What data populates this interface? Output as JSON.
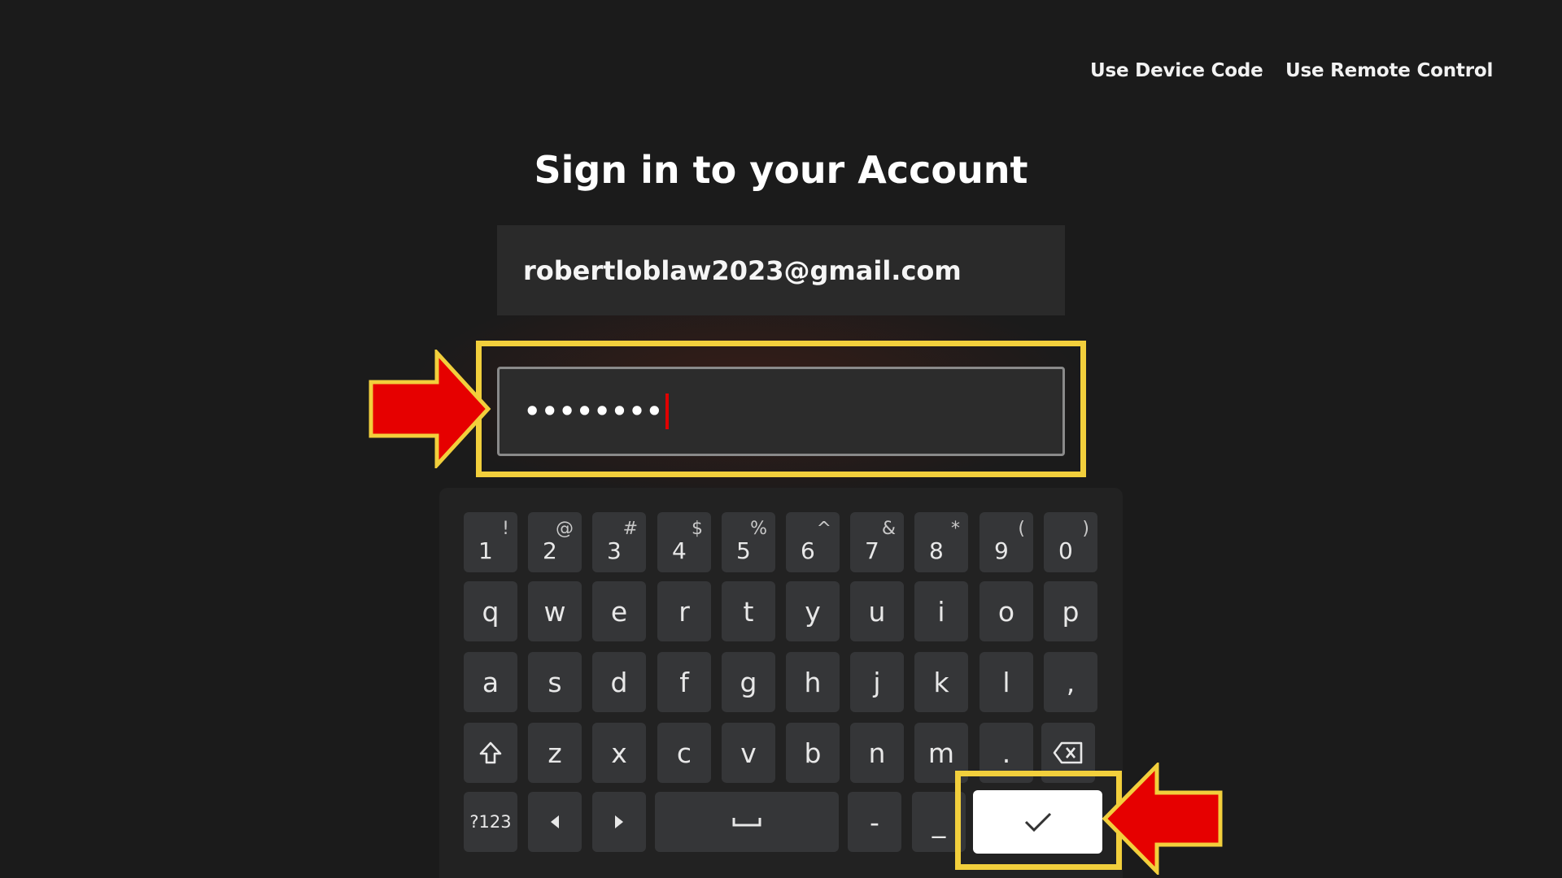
{
  "header": {
    "device_code_label": "Use Device Code",
    "remote_control_label": "Use Remote Control"
  },
  "title": "Sign in to your Account",
  "email_field": {
    "value": "robertloblaw2023@gmail.com"
  },
  "password_field": {
    "masked_value": "••••••••"
  },
  "keyboard": {
    "number_row": [
      {
        "main": "1",
        "alt": "!"
      },
      {
        "main": "2",
        "alt": "@"
      },
      {
        "main": "3",
        "alt": "#"
      },
      {
        "main": "4",
        "alt": "$"
      },
      {
        "main": "5",
        "alt": "%"
      },
      {
        "main": "6",
        "alt": "^"
      },
      {
        "main": "7",
        "alt": "&"
      },
      {
        "main": "8",
        "alt": "*"
      },
      {
        "main": "9",
        "alt": "("
      },
      {
        "main": "0",
        "alt": ")"
      }
    ],
    "row_q": [
      "q",
      "w",
      "e",
      "r",
      "t",
      "y",
      "u",
      "i",
      "o",
      "p"
    ],
    "row_a": [
      "a",
      "s",
      "d",
      "f",
      "g",
      "h",
      "j",
      "k",
      "l",
      ","
    ],
    "row_z": [
      "z",
      "x",
      "c",
      "v",
      "b",
      "n",
      "m",
      "."
    ],
    "symbols_label": "?123",
    "dash_label": "-",
    "underscore_label": "_",
    "icons": {
      "shift": "shift-icon",
      "backspace": "backspace-icon",
      "left": "arrow-left-icon",
      "right": "arrow-right-icon",
      "space": "space-icon",
      "done": "checkmark-icon"
    }
  },
  "annotations": {
    "highlight_color": "#f2cf3c",
    "arrow_color": "#e60000"
  }
}
